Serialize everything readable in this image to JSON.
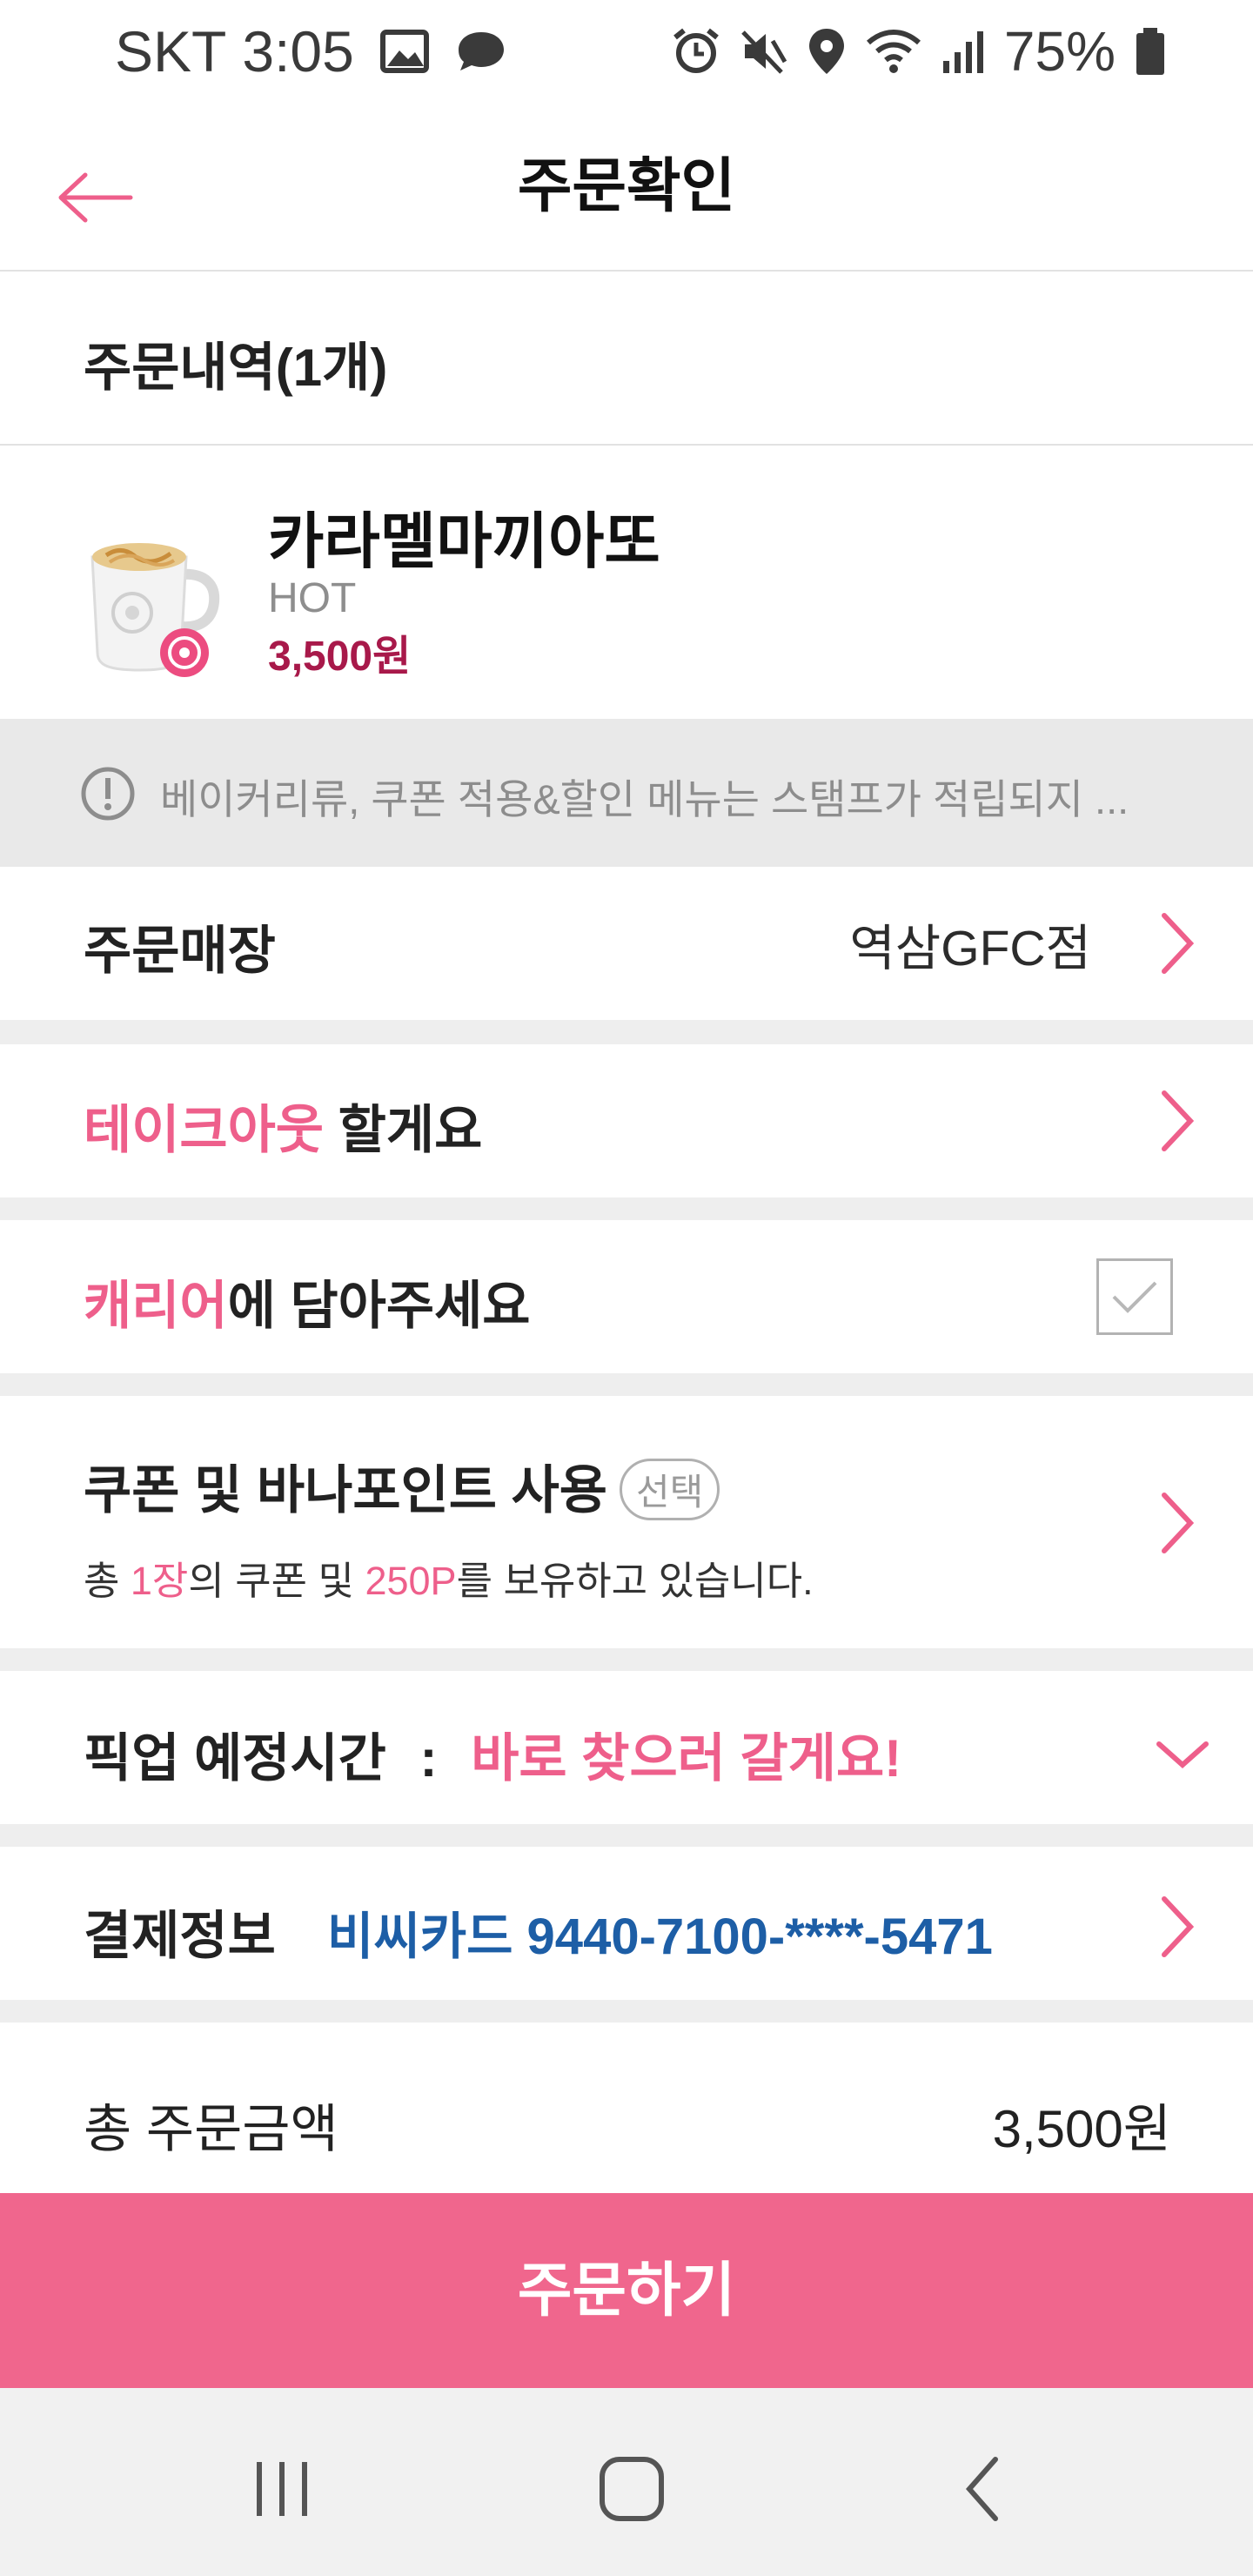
{
  "status_bar": {
    "carrier": "SKT",
    "time": "3:05",
    "battery": "75%",
    "left_icons": [
      "gallery-icon",
      "chat-bubble-icon"
    ],
    "right_icons": [
      "alarm-icon",
      "mute-icon",
      "location-icon",
      "wifi-icon",
      "signal-icon",
      "battery-icon"
    ]
  },
  "header": {
    "title": "주문확인",
    "back_icon": "back-arrow-icon"
  },
  "order_history": {
    "title": "주문내역(1개)",
    "item": {
      "name": "카라멜마끼아또",
      "option": "HOT",
      "price": "3,500원",
      "image_icon": "coffee-cup-icon"
    }
  },
  "notice": {
    "icon": "exclamation-circle-icon",
    "text": "베이커리류, 쿠폰 적용&할인 메뉴는 스탬프가 적립되지 ..."
  },
  "store": {
    "label": "주문매장",
    "value": "역삼GFC점"
  },
  "takeout": {
    "highlight": "테이크아웃",
    "rest": " 할게요"
  },
  "carrier": {
    "highlight": "캐리어",
    "rest": "에 담아주세요",
    "checked": true
  },
  "coupon": {
    "title": "쿠폰 및 바나포인트 사용",
    "badge": "선택",
    "sub_prefix": "총 ",
    "sub_count": "1장",
    "sub_mid": "의 쿠폰 및 ",
    "sub_points": "250P",
    "sub_suffix": "를 보유하고 있습니다."
  },
  "pickup": {
    "label": "픽업 예정시간",
    "separator": ":",
    "value": "바로 찾으러 갈게요!"
  },
  "payment": {
    "label": "결제정보",
    "value": "비씨카드 9440-7100-****-5471"
  },
  "total": {
    "label": "총 주문금액",
    "value": "3,500원"
  },
  "order_button": {
    "label": "주문하기"
  },
  "nav": {
    "recent": "recent-apps-icon",
    "home": "home-icon",
    "back": "back-icon"
  },
  "colors": {
    "accent": "#f0668d",
    "price": "#a8194a",
    "payment": "#1d5ea6"
  }
}
